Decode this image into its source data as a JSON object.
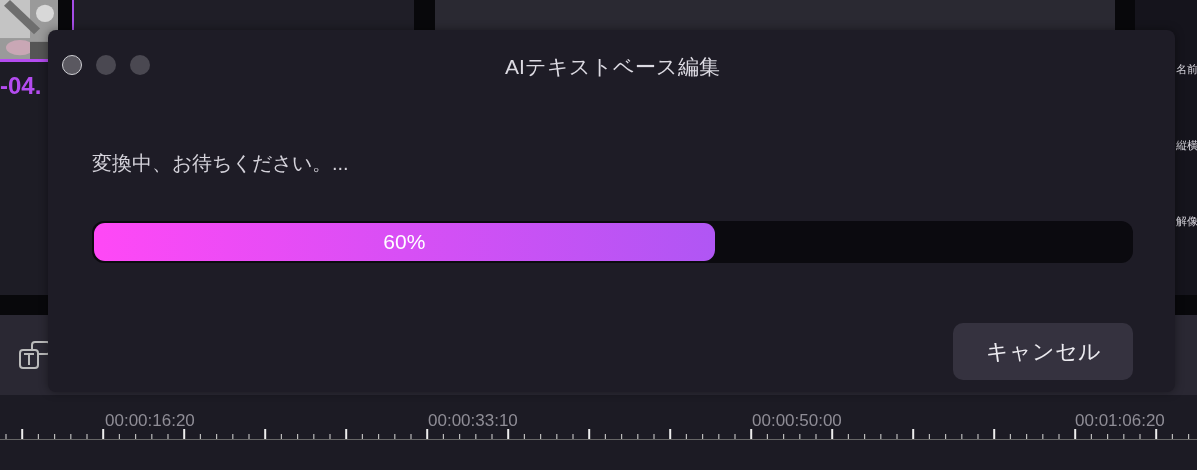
{
  "background": {
    "clip_label": "-04.",
    "panel_labels": [
      "名前",
      "縦横",
      "解像"
    ],
    "ruler_labels": [
      "00:00:16:20",
      "00:00:33:10",
      "00:00:50:00",
      "00:01:06:20"
    ]
  },
  "dialog": {
    "title": "AIテキストベース編集",
    "message": "変換中、お待ちください。...",
    "progress": {
      "level": 0.6,
      "reading": "60%"
    },
    "buttons": [
      {
        "label": "キャンセル"
      }
    ]
  }
}
